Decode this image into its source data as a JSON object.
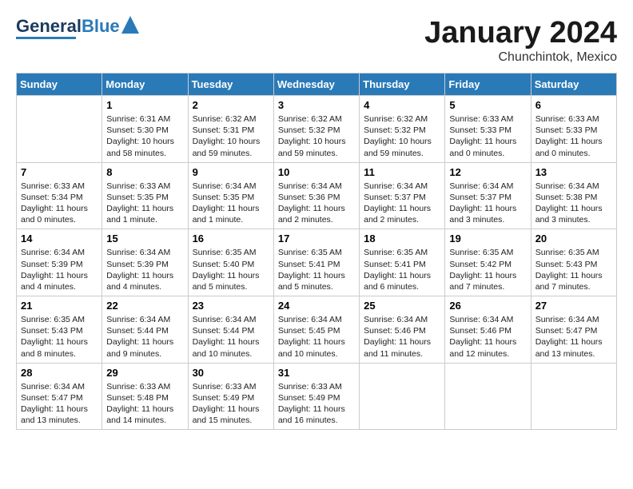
{
  "header": {
    "logo_general": "General",
    "logo_blue": "Blue",
    "month_title": "January 2024",
    "location": "Chunchintok, Mexico"
  },
  "days_of_week": [
    "Sunday",
    "Monday",
    "Tuesday",
    "Wednesday",
    "Thursday",
    "Friday",
    "Saturday"
  ],
  "weeks": [
    [
      {
        "day": "",
        "content": ""
      },
      {
        "day": "1",
        "content": "Sunrise: 6:31 AM\nSunset: 5:30 PM\nDaylight: 10 hours\nand 58 minutes."
      },
      {
        "day": "2",
        "content": "Sunrise: 6:32 AM\nSunset: 5:31 PM\nDaylight: 10 hours\nand 59 minutes."
      },
      {
        "day": "3",
        "content": "Sunrise: 6:32 AM\nSunset: 5:32 PM\nDaylight: 10 hours\nand 59 minutes."
      },
      {
        "day": "4",
        "content": "Sunrise: 6:32 AM\nSunset: 5:32 PM\nDaylight: 10 hours\nand 59 minutes."
      },
      {
        "day": "5",
        "content": "Sunrise: 6:33 AM\nSunset: 5:33 PM\nDaylight: 11 hours\nand 0 minutes."
      },
      {
        "day": "6",
        "content": "Sunrise: 6:33 AM\nSunset: 5:33 PM\nDaylight: 11 hours\nand 0 minutes."
      }
    ],
    [
      {
        "day": "7",
        "content": "Sunrise: 6:33 AM\nSunset: 5:34 PM\nDaylight: 11 hours\nand 0 minutes."
      },
      {
        "day": "8",
        "content": "Sunrise: 6:33 AM\nSunset: 5:35 PM\nDaylight: 11 hours\nand 1 minute."
      },
      {
        "day": "9",
        "content": "Sunrise: 6:34 AM\nSunset: 5:35 PM\nDaylight: 11 hours\nand 1 minute."
      },
      {
        "day": "10",
        "content": "Sunrise: 6:34 AM\nSunset: 5:36 PM\nDaylight: 11 hours\nand 2 minutes."
      },
      {
        "day": "11",
        "content": "Sunrise: 6:34 AM\nSunset: 5:37 PM\nDaylight: 11 hours\nand 2 minutes."
      },
      {
        "day": "12",
        "content": "Sunrise: 6:34 AM\nSunset: 5:37 PM\nDaylight: 11 hours\nand 3 minutes."
      },
      {
        "day": "13",
        "content": "Sunrise: 6:34 AM\nSunset: 5:38 PM\nDaylight: 11 hours\nand 3 minutes."
      }
    ],
    [
      {
        "day": "14",
        "content": "Sunrise: 6:34 AM\nSunset: 5:39 PM\nDaylight: 11 hours\nand 4 minutes."
      },
      {
        "day": "15",
        "content": "Sunrise: 6:34 AM\nSunset: 5:39 PM\nDaylight: 11 hours\nand 4 minutes."
      },
      {
        "day": "16",
        "content": "Sunrise: 6:35 AM\nSunset: 5:40 PM\nDaylight: 11 hours\nand 5 minutes."
      },
      {
        "day": "17",
        "content": "Sunrise: 6:35 AM\nSunset: 5:41 PM\nDaylight: 11 hours\nand 5 minutes."
      },
      {
        "day": "18",
        "content": "Sunrise: 6:35 AM\nSunset: 5:41 PM\nDaylight: 11 hours\nand 6 minutes."
      },
      {
        "day": "19",
        "content": "Sunrise: 6:35 AM\nSunset: 5:42 PM\nDaylight: 11 hours\nand 7 minutes."
      },
      {
        "day": "20",
        "content": "Sunrise: 6:35 AM\nSunset: 5:43 PM\nDaylight: 11 hours\nand 7 minutes."
      }
    ],
    [
      {
        "day": "21",
        "content": "Sunrise: 6:35 AM\nSunset: 5:43 PM\nDaylight: 11 hours\nand 8 minutes."
      },
      {
        "day": "22",
        "content": "Sunrise: 6:34 AM\nSunset: 5:44 PM\nDaylight: 11 hours\nand 9 minutes."
      },
      {
        "day": "23",
        "content": "Sunrise: 6:34 AM\nSunset: 5:44 PM\nDaylight: 11 hours\nand 10 minutes."
      },
      {
        "day": "24",
        "content": "Sunrise: 6:34 AM\nSunset: 5:45 PM\nDaylight: 11 hours\nand 10 minutes."
      },
      {
        "day": "25",
        "content": "Sunrise: 6:34 AM\nSunset: 5:46 PM\nDaylight: 11 hours\nand 11 minutes."
      },
      {
        "day": "26",
        "content": "Sunrise: 6:34 AM\nSunset: 5:46 PM\nDaylight: 11 hours\nand 12 minutes."
      },
      {
        "day": "27",
        "content": "Sunrise: 6:34 AM\nSunset: 5:47 PM\nDaylight: 11 hours\nand 13 minutes."
      }
    ],
    [
      {
        "day": "28",
        "content": "Sunrise: 6:34 AM\nSunset: 5:47 PM\nDaylight: 11 hours\nand 13 minutes."
      },
      {
        "day": "29",
        "content": "Sunrise: 6:33 AM\nSunset: 5:48 PM\nDaylight: 11 hours\nand 14 minutes."
      },
      {
        "day": "30",
        "content": "Sunrise: 6:33 AM\nSunset: 5:49 PM\nDaylight: 11 hours\nand 15 minutes."
      },
      {
        "day": "31",
        "content": "Sunrise: 6:33 AM\nSunset: 5:49 PM\nDaylight: 11 hours\nand 16 minutes."
      },
      {
        "day": "",
        "content": ""
      },
      {
        "day": "",
        "content": ""
      },
      {
        "day": "",
        "content": ""
      }
    ]
  ]
}
